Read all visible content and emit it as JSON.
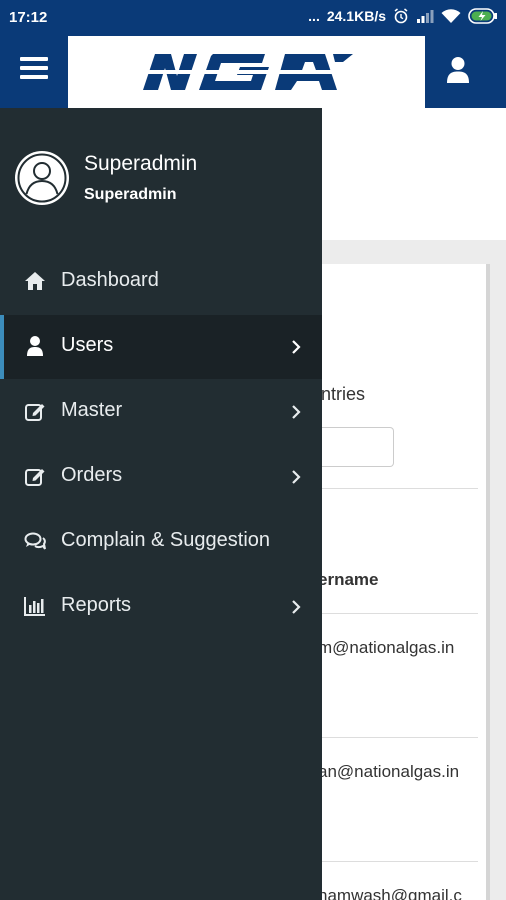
{
  "statusbar": {
    "time": "17:12",
    "dots": "...",
    "speed": "24.1KB/s",
    "icons": [
      "alarm-icon",
      "signal-icon",
      "wifi-icon",
      "battery-charging-icon"
    ]
  },
  "header": {
    "logo_text": "NGA",
    "menu_icon": "hamburger-icon",
    "user_icon": "user-icon"
  },
  "drawer": {
    "profile": {
      "name": "Superadmin",
      "role": "Superadmin"
    },
    "items": [
      {
        "label": "Dashboard",
        "icon": "home-icon",
        "has_submenu": false,
        "active": false
      },
      {
        "label": "Users",
        "icon": "user-icon",
        "has_submenu": true,
        "active": true
      },
      {
        "label": "Master",
        "icon": "edit-icon",
        "has_submenu": true,
        "active": false
      },
      {
        "label": "Orders",
        "icon": "edit-icon",
        "has_submenu": true,
        "active": false
      },
      {
        "label": "Complain & Suggestion",
        "icon": "comments-icon",
        "has_submenu": false,
        "active": false
      },
      {
        "label": "Reports",
        "icon": "bar-chart-icon",
        "has_submenu": true,
        "active": false
      }
    ]
  },
  "background": {
    "entries_text": "ntries",
    "column_header": "ername",
    "rows": [
      "m@nationalgas.in",
      "an@nationalgas.in",
      "hamwash@gmail.c"
    ]
  },
  "colors": {
    "brand": "#0a3a78",
    "drawer_bg": "#222d32",
    "drawer_active": "#1a2226",
    "accent": "#3c8dbc"
  }
}
